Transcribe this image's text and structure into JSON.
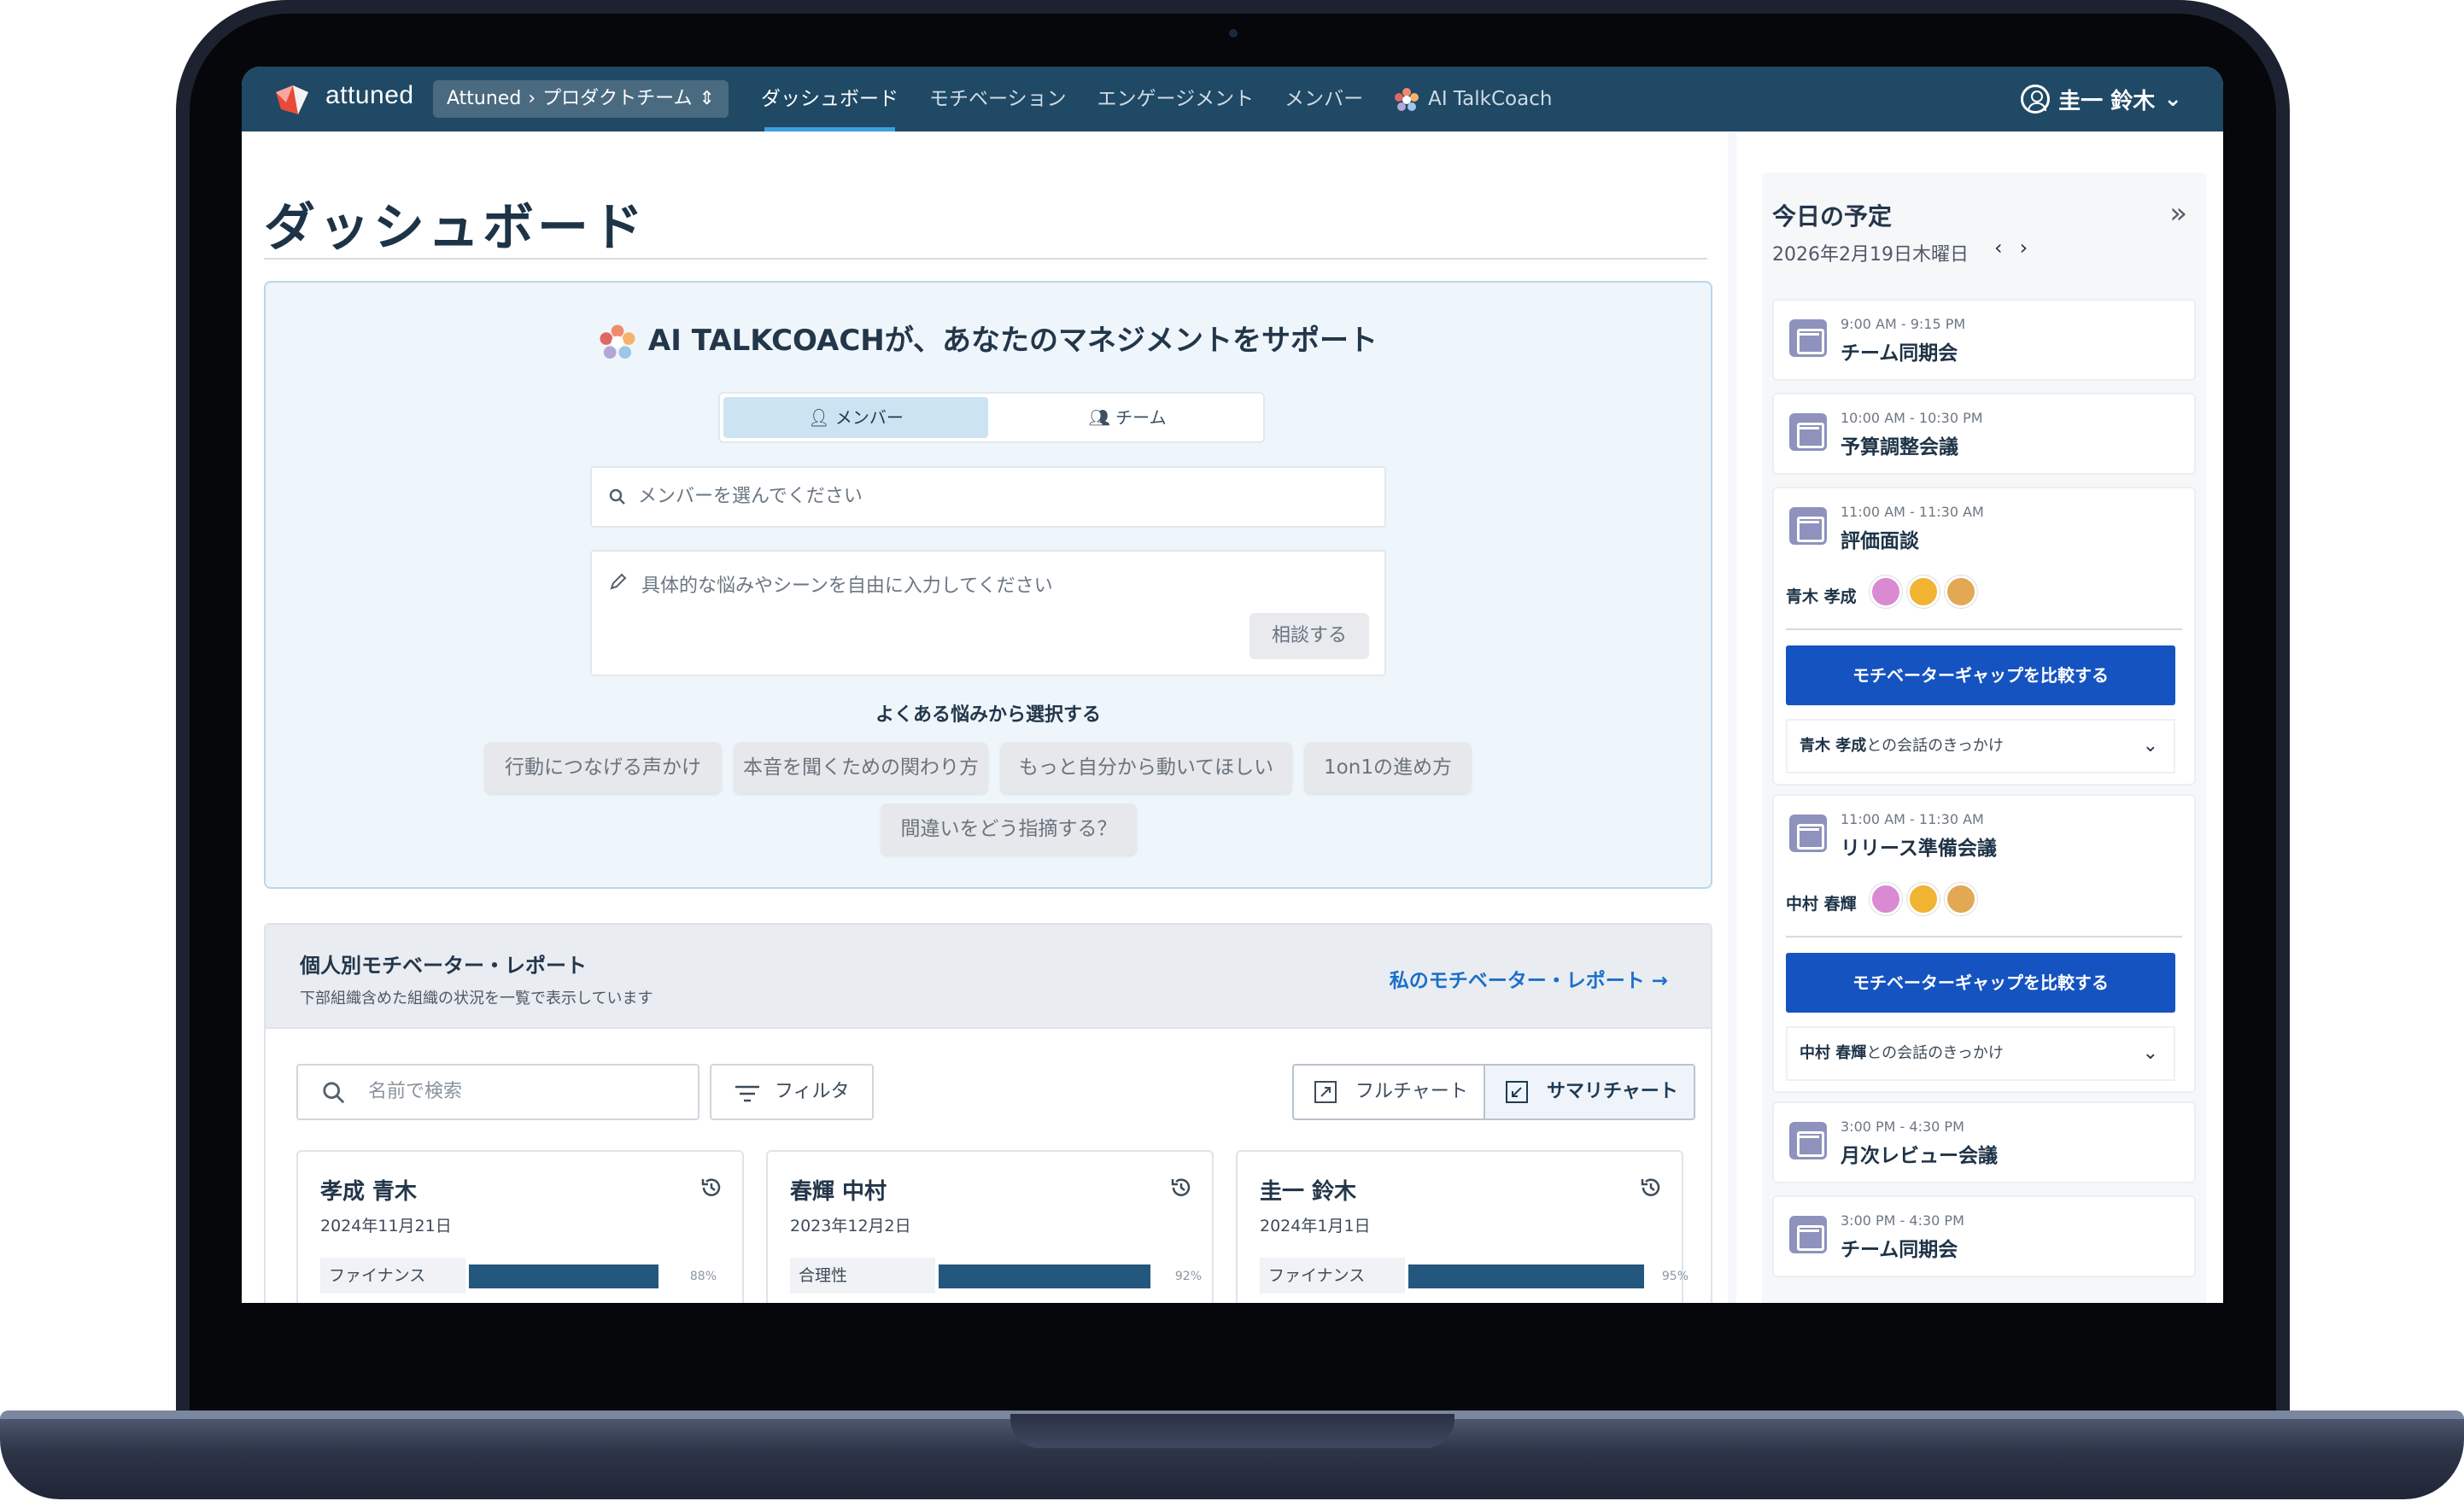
{
  "app": {
    "logo_text": "attuned",
    "breadcrumb": {
      "org": "Attuned",
      "separator": "›",
      "team": "プロダクトチーム",
      "caret": "⇕"
    },
    "nav": [
      {
        "label": "ダッシュボード",
        "active": true
      },
      {
        "label": "モチベーション",
        "active": false
      },
      {
        "label": "エンゲージメント",
        "active": false
      },
      {
        "label": "メンバー",
        "active": false
      },
      {
        "label": "AI TalkCoach",
        "active": false
      }
    ],
    "user": {
      "name": "圭一 鈴木",
      "caret": "⌄"
    }
  },
  "dashboard": {
    "title": "ダッシュボード",
    "ai_panel": {
      "heading": "AI TALKCOACHが、あなたのマネジメントをサポート",
      "toggle": {
        "member": "メンバー",
        "team": "チーム",
        "selected": "member"
      },
      "member_placeholder": "メンバーを選んでください",
      "concern_placeholder": "具体的な悩みやシーンを自由に入力してください",
      "consult_button": "相談する",
      "choose_title": "よくある悩みから選択する",
      "chips": [
        "行動につなげる声かけ",
        "本音を聞くための関わり方",
        "もっと自分から動いてほしい",
        "1on1の進め方",
        "間違いをどう指摘する？"
      ]
    },
    "report": {
      "title": "個人別モチベーター・レポート",
      "subtitle": "下部組織含めた組織の状況を一覧で表示しています",
      "my_report_link": "私のモチベーター・レポート →",
      "search_placeholder": "名前で検索",
      "filter_label": "フィルタ",
      "view_full": "フルチャート",
      "view_summary": "サマリチャート",
      "cards": [
        {
          "name": "孝成 青木",
          "date": "2024年11月21日",
          "motivator": "ファイナンス",
          "percent": 88,
          "percent_label": "88%"
        },
        {
          "name": "春輝 中村",
          "date": "2023年12月2日",
          "motivator": "合理性",
          "percent": 92,
          "percent_label": "92%"
        },
        {
          "name": "圭一 鈴木",
          "date": "2024年1月1日",
          "motivator": "ファイナンス",
          "percent": 95,
          "percent_label": "95%"
        }
      ]
    }
  },
  "schedule": {
    "title": "今日の予定",
    "date": "2026年2月19日木曜日",
    "prev": "‹",
    "next": "›",
    "collapse": "»",
    "events": [
      {
        "time": "9:00 AM - 9:15 PM",
        "title": "チーム同期会"
      },
      {
        "time": "10:00 AM - 10:30 PM",
        "title": "予算調整会議"
      },
      {
        "time": "11:00 AM - 11:30 AM",
        "title": "評価面談",
        "attendee": "青木 孝成",
        "compare_button": "モチベーターギャップを比較する",
        "hook_name": "青木 孝成",
        "hook_suffix": "との会話のきっかけ"
      },
      {
        "time": "11:00 AM - 11:30 AM",
        "title": "リリース準備会議",
        "attendee": "中村 春輝",
        "compare_button": "モチベーターギャップを比較する",
        "hook_name": "中村 春輝",
        "hook_suffix": "との会話のきっかけ"
      },
      {
        "time": "3:00 PM - 4:30 PM",
        "title": "月次レビュー会議"
      },
      {
        "time": "3:00 PM - 4:30 PM",
        "title": "チーム同期会"
      }
    ]
  },
  "colors": {
    "topbar": "#1f4965",
    "primary_button": "#1553c0",
    "link": "#1b6fc9",
    "bar_fill": "#24577d",
    "motivator_pink": "#d98ad2",
    "motivator_gold": "#f0b432",
    "motivator_tan": "#e3a854"
  },
  "icons": [
    "attuned-logo-icon",
    "talkcoach-icon",
    "user-circle-icon",
    "person-icon",
    "team-icon",
    "search-icon",
    "pencil-icon",
    "filter-icon",
    "expand-icon",
    "collapse-icon",
    "history-icon",
    "calendar-icon",
    "chevron-down-icon",
    "double-chevron-right-icon"
  ]
}
